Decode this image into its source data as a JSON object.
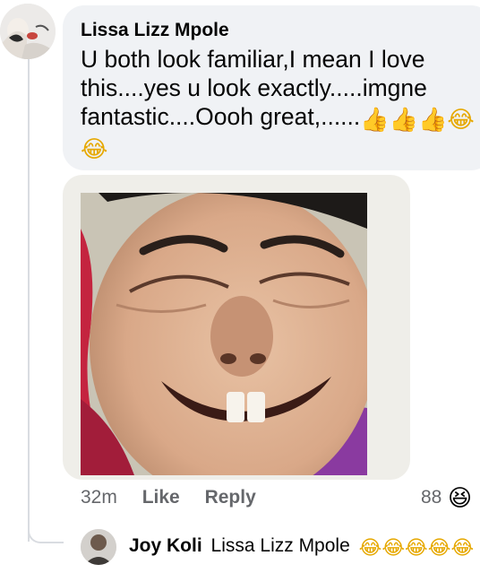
{
  "comment": {
    "author": "Lissa Lizz Mpole",
    "text": "U both look familiar,I mean I love this....yes u look exactly.....imgne fantastic....Oooh great,......",
    "trailing_emojis": [
      "👍",
      "👍",
      "👍",
      "😂",
      "😂"
    ]
  },
  "actions": {
    "time": "32m",
    "like_label": "Like",
    "reply_label": "Reply",
    "reaction_count": "88",
    "reaction_emoji": "😆"
  },
  "reply": {
    "author": "Joy Koli",
    "mention": "Lissa Lizz Mpole",
    "emojis": [
      "😂",
      "😂",
      "😂",
      "😂",
      "😂"
    ]
  },
  "icons": {
    "comment_avatar": "user-avatar-icon",
    "reply_avatar": "user-avatar-icon",
    "attached_image": "laughing-face-photo"
  },
  "colors": {
    "bubble_bg": "#f0f2f5",
    "action_text": "#65676b",
    "primary_text": "#050505",
    "thread_line": "#d9dce1"
  }
}
